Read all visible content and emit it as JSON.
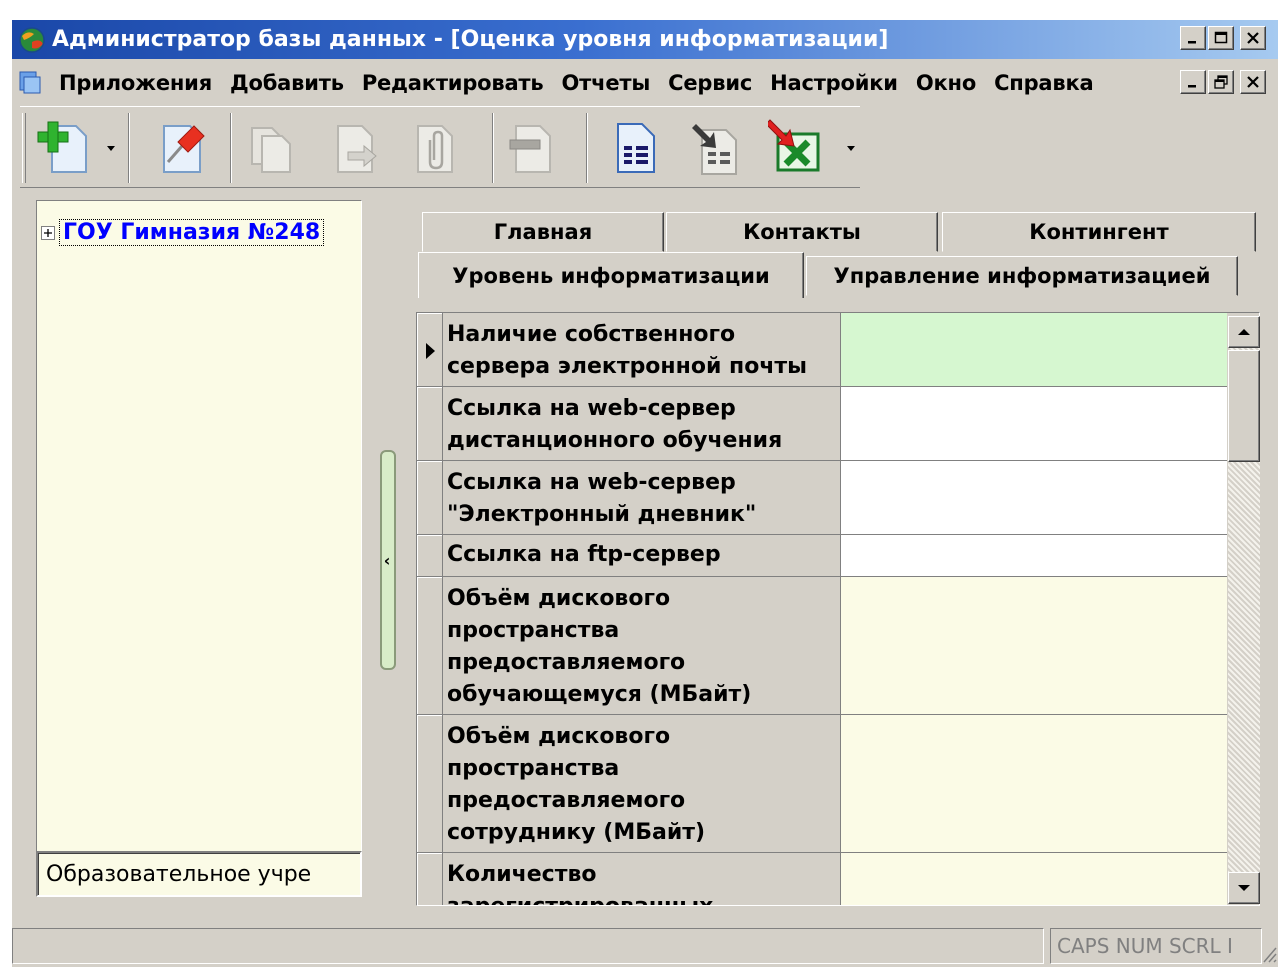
{
  "window": {
    "title": "Администратор базы данных - [Оценка уровня информатизации]"
  },
  "menu": {
    "items": [
      "Приложения",
      "Добавить",
      "Редактировать",
      "Отчеты",
      "Сервис",
      "Настройки",
      "Окно",
      "Справка"
    ]
  },
  "toolbar": {
    "buttons": [
      {
        "icon": "add-document-icon",
        "state": "enabled",
        "has_dropdown": true
      },
      {
        "icon": "pin-icon",
        "state": "enabled"
      },
      {
        "icon": "copy-icon",
        "state": "disabled"
      },
      {
        "icon": "move-icon",
        "state": "disabled"
      },
      {
        "icon": "attach-icon",
        "state": "disabled"
      },
      {
        "icon": "delete-icon",
        "state": "disabled"
      },
      {
        "icon": "list-document-icon",
        "state": "enabled"
      },
      {
        "icon": "import-icon",
        "state": "enabled"
      },
      {
        "icon": "excel-export-icon",
        "state": "enabled",
        "has_dropdown": true
      }
    ]
  },
  "tree": {
    "root": {
      "label": "ГОУ Гимназия №248",
      "expanded": false
    }
  },
  "left_footer": {
    "text": "Образовательное учре"
  },
  "tabs": {
    "row_top": [
      "Главная",
      "Контакты",
      "Контингент"
    ],
    "row_bottom": [
      "Уровень информатизации",
      "Управление информатизацией"
    ],
    "active": "Уровень информатизации"
  },
  "grid": {
    "rows": [
      {
        "label": "Наличие собственного сервера электронной почты",
        "value": "",
        "bg": "#d6f7d0",
        "current": true
      },
      {
        "label": "Ссылка на web-сервер дистанционного обучения",
        "value": "",
        "bg": "#ffffff"
      },
      {
        "label": "Ссылка на web-сервер \"Электронный дневник\"",
        "value": "",
        "bg": "#ffffff"
      },
      {
        "label": "Ссылка на ftp-сервер",
        "value": "",
        "bg": "#ffffff"
      },
      {
        "label": "Объём дискового пространства предоставляемого обучающемуся (МБайт)",
        "value": "",
        "bg": "#fbfbe6"
      },
      {
        "label": "Объём дискового пространства предоставляемого сотруднику (МБайт)",
        "value": "",
        "bg": "#fbfbe6"
      },
      {
        "label": "Количество зарегистрированных",
        "value": "",
        "bg": "#fbfbe6"
      }
    ]
  },
  "statusbar": {
    "keys": "CAPS NUM SCRL I"
  },
  "colors": {
    "title_gradient_start": "#1a47a8",
    "title_gradient_end": "#a6caf0",
    "tree_link": "#0000ff",
    "panel_bg": "#fbfbe6",
    "current_row": "#d6f7d0"
  }
}
